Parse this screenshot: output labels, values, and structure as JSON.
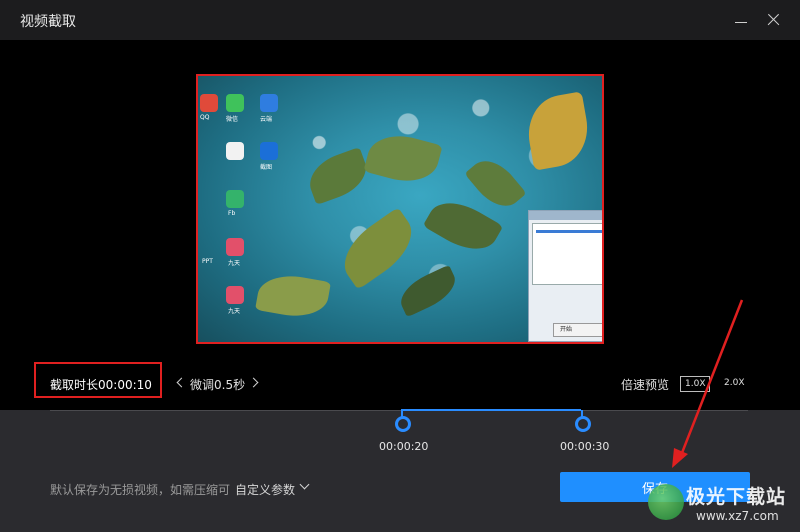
{
  "window": {
    "title": "视频截取",
    "minimize_icon": "minimize-icon",
    "close_icon": "close-icon"
  },
  "preview": {
    "desktop_labels": [
      "QQ",
      "微信",
      "云端",
      "PPT",
      "Fb",
      "九天",
      "九天",
      "截图"
    ],
    "dialog_button": "开始"
  },
  "controls": {
    "duration": "截取时长00:00:10",
    "fine_tune": "微调0.5秒",
    "speed_label": "倍速预览",
    "speed_options": [
      "1.0X",
      "2.0X"
    ],
    "selected_speed": "1.0X"
  },
  "timeline": {
    "start": "00:00:20",
    "end": "00:00:30",
    "accent_color": "#2a8cff"
  },
  "footer": {
    "note": "默认保存为无损视频，如需压缩可",
    "custom_params": "自定义参数",
    "save": "保存"
  },
  "watermark": {
    "name": "极光下载站",
    "url": "www.xz7.com"
  },
  "colors": {
    "highlight_red": "#e02020",
    "primary_blue": "#1f8fff",
    "background": "#1c1c1e"
  }
}
